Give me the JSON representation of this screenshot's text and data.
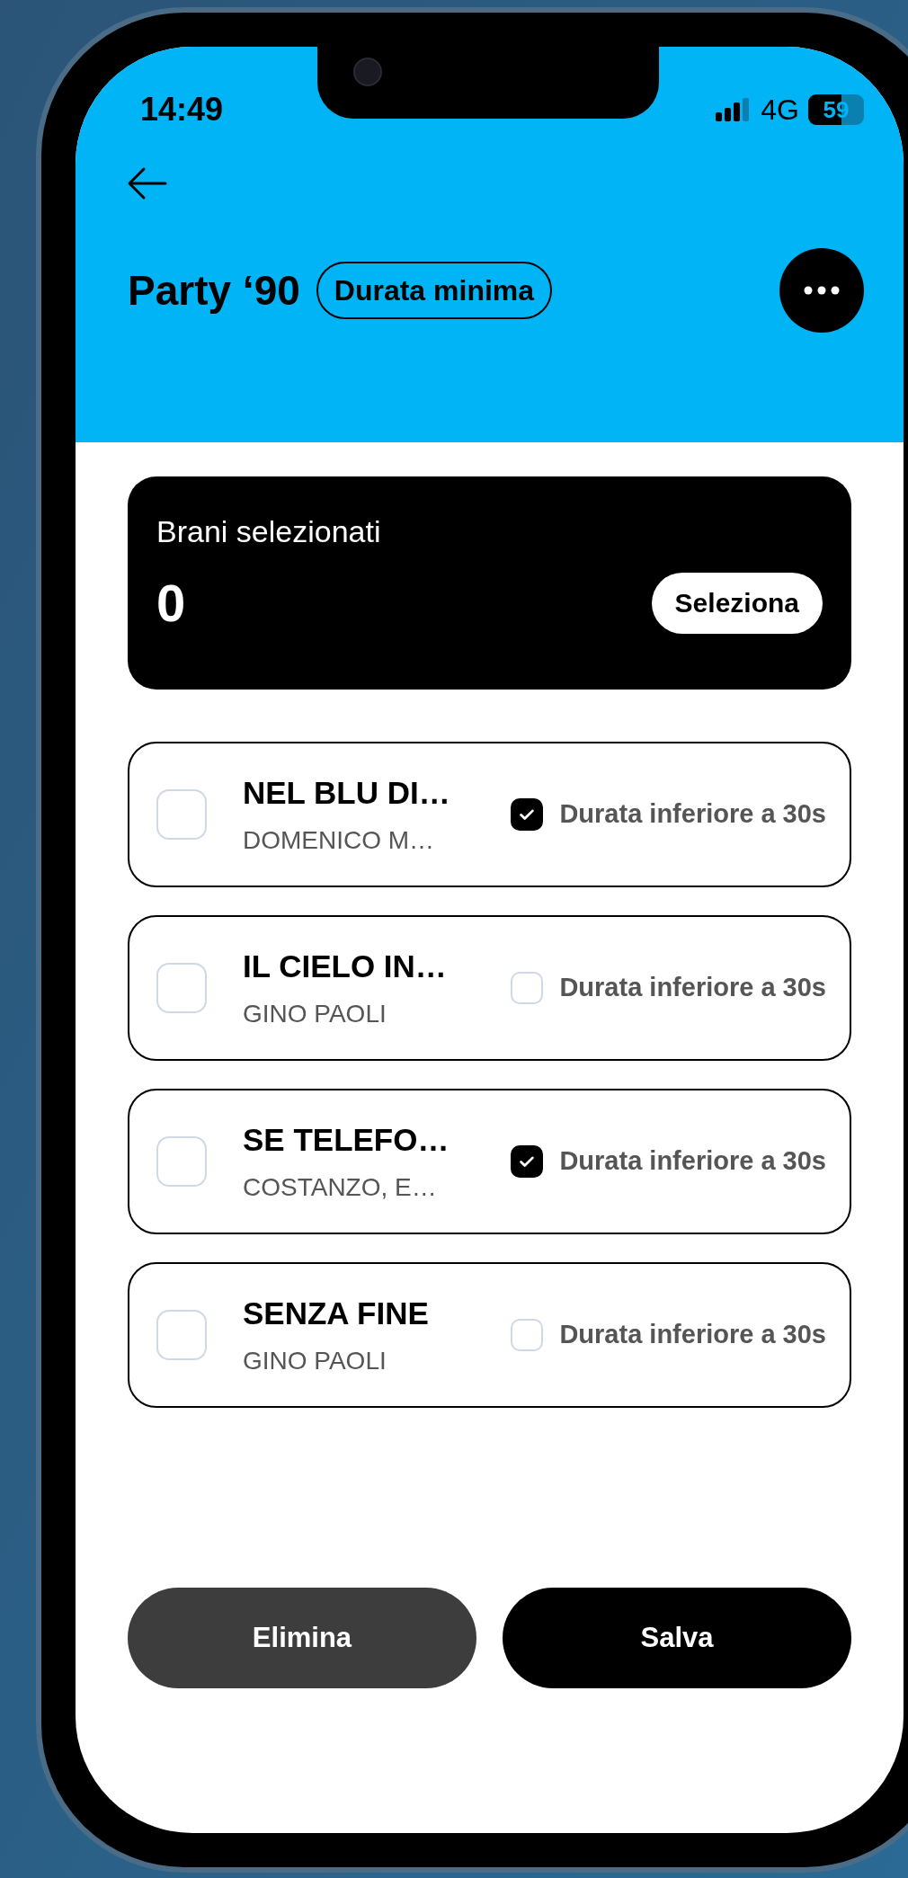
{
  "status_bar": {
    "time": "14:49",
    "network": "4G",
    "battery": {
      "text": "59",
      "level": 0.59
    }
  },
  "header": {
    "title": "Party ‘90",
    "badge": "Durata minima"
  },
  "summary": {
    "label": "Brani selezionati",
    "count": "0",
    "button": "Seleziona"
  },
  "songs": [
    {
      "title": "NEL BLU DI…",
      "artist": "DOMENICO M…",
      "checked": false,
      "short": {
        "label": "Durata inferiore a 30s",
        "checked": true
      }
    },
    {
      "title": "IL CIELO IN…",
      "artist": "GINO PAOLI",
      "checked": false,
      "short": {
        "label": "Durata inferiore a 30s",
        "checked": false
      }
    },
    {
      "title": "SE TELEFO…",
      "artist": "COSTANZO, E…",
      "checked": false,
      "short": {
        "label": "Durata inferiore a 30s",
        "checked": true
      }
    },
    {
      "title": "SENZA FINE",
      "artist": "GINO PAOLI",
      "checked": false,
      "short": {
        "label": "Durata inferiore a 30s",
        "checked": false
      }
    }
  ],
  "actions": [
    {
      "label": "Elimina",
      "kind": "secondary"
    },
    {
      "label": "Salva",
      "kind": "primary"
    }
  ]
}
